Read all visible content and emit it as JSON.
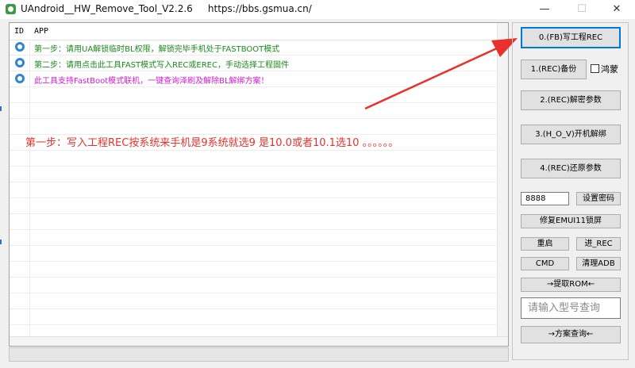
{
  "window": {
    "title": "UAndroid__HW_Remove_Tool_V2.2.6     https://bbs.gsmua.cn/",
    "minimize": "—",
    "maximize": "☐",
    "close": "✕"
  },
  "list": {
    "columns": [
      "ID",
      "APP"
    ],
    "rows": [
      {
        "text": "第一步：请用UA解锁临时BL权限，解锁完毕手机处于FASTBOOT模式",
        "color": "#1a8a1a"
      },
      {
        "text": "第二步：请用点击此工具FAST模式写入REC或EREC，手动选择工程固件",
        "color": "#1a8a1a"
      },
      {
        "text": "此工具支持FastBoot模式联机，一键查询泽刷及解除BL解绑方案！",
        "color": "#d41ad4"
      }
    ]
  },
  "annotation": {
    "text": "第一步：写入工程REC按系统来手机是9系统就选9  是10.0或者10.1选10    。。。。。。",
    "color": "#e8312a"
  },
  "buttons": {
    "write_rec": "0.(FB)写工程REC",
    "backup": "1.(REC)备份",
    "decrypt": "2.(REC)解密参数",
    "unbind": "3.(H_O_V)开机解绑",
    "restore": "4.(REC)还原参数",
    "set_password": "设置密码",
    "repair_emui": "修复EMUI11锁屏",
    "reboot": "重启",
    "enter_rec": "进_REC",
    "cmd": "CMD",
    "clear_adb": "清理ADB",
    "extract_rom": "→提取ROM←",
    "query_plan": "→方案查询←"
  },
  "checkbox": {
    "label": "鸿蒙"
  },
  "password": {
    "value": "8888"
  },
  "search": {
    "placeholder": "请输入型号查询"
  },
  "colors": {
    "arrow": "#e8312a",
    "row_icon": "#2f84d6",
    "app_icon": "#3c9a44"
  }
}
